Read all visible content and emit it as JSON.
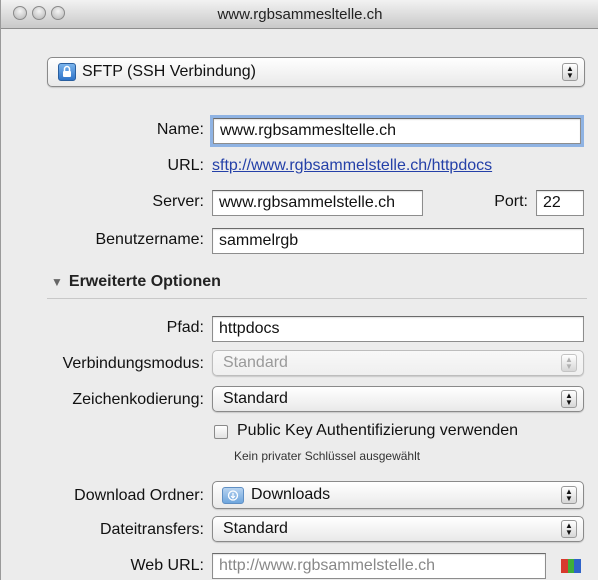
{
  "window": {
    "title": "www.rgbsammesltelle.ch"
  },
  "protocol": {
    "selected": "SFTP (SSH Verbindung)",
    "icon": "lock-icon"
  },
  "name": {
    "label": "Name:",
    "value": "www.rgbsammesltelle.ch"
  },
  "url": {
    "label": "URL:",
    "value": "sftp://www.rgbsammelstelle.ch/httpdocs"
  },
  "server": {
    "label": "Server:",
    "value": "www.rgbsammelstelle.ch"
  },
  "port": {
    "label": "Port:",
    "value": "22"
  },
  "username": {
    "label": "Benutzername:",
    "value": "sammelrgb"
  },
  "advanced": {
    "label": "Erweiterte Optionen"
  },
  "path": {
    "label": "Pfad:",
    "value": "httpdocs"
  },
  "connection_mode": {
    "label": "Verbindungsmodus:",
    "value": "Standard"
  },
  "encoding": {
    "label": "Zeichenkodierung:",
    "value": "Standard"
  },
  "public_key": {
    "label": "Public Key Authentifizierung verwenden",
    "note": "Kein privater Schlüssel ausgewählt"
  },
  "download_folder": {
    "label": "Download Ordner:",
    "value": "Downloads",
    "icon": "folder-icon"
  },
  "transfers": {
    "label": "Dateitransfers:",
    "value": "Standard"
  },
  "web_url": {
    "label": "Web URL:",
    "placeholder": "http://www.rgbsammelstelle.ch"
  }
}
